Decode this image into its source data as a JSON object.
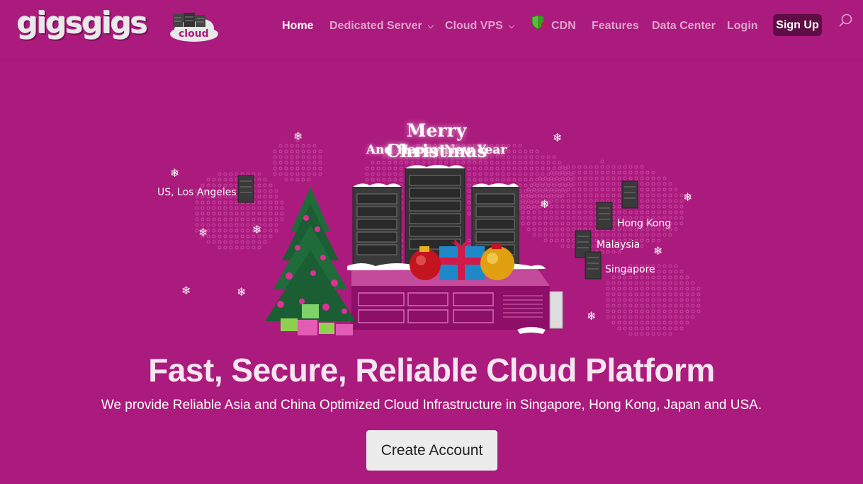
{
  "logo": {
    "wordmark": "gigsgigs",
    "badge": "cloud"
  },
  "nav": {
    "home": "Home",
    "dedicated": "Dedicated Server",
    "cloud_vps": "Cloud VPS",
    "cdn": "CDN",
    "features": "Features",
    "data_center": "Data Center",
    "login": "Login",
    "signup": "Sign Up"
  },
  "hero": {
    "greeting_line1": "Merry Christmas",
    "greeting_line2": "And Happy New Year",
    "locations": {
      "la": "US, Los Angeles",
      "hk": "Hong Kong",
      "my": "Malaysia",
      "sg": "Singapore"
    }
  },
  "headline": "Fast, Secure, Reliable Cloud Platform",
  "subtext": "We provide Reliable Asia and China Optimized Cloud Infrastructure in Singapore, Hong Kong, Japan and USA.",
  "cta": "Create Account",
  "colors": {
    "background": "#ab1a7d",
    "signup_bg": "#5f0d45",
    "button_bg": "#ececec"
  }
}
